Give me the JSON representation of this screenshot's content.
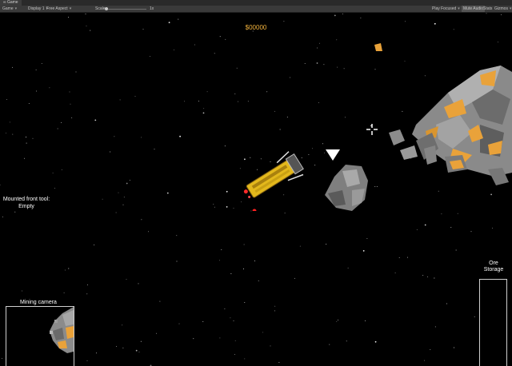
{
  "window": {
    "tab_title": "Game"
  },
  "toolbar": {
    "game_label": "Game",
    "display": "Display 1",
    "aspect": "Free Aspect",
    "scale_label": "Scale",
    "scale_value": "1x",
    "play_mode": "Play Focused",
    "mute_audio": "Mute Audio",
    "stats": "Stats",
    "gizmos": "Gizmos"
  },
  "hud": {
    "credits": "$00000",
    "mounted_tool": "Mounted front tool:\nEmpty",
    "mining_camera_label": "Mining camera",
    "ore_storage_label": "Ore\nStorage",
    "ore_storage_fill": 0
  },
  "colors": {
    "credits": "#f2b33d",
    "background": "#000000",
    "hud_text": "#ffffff",
    "ore_gold": "#e9a23a",
    "ship_yellow": "#e3b81c"
  },
  "icons": {
    "crosshair": "crosshair-icon",
    "target_marker": "target-marker-icon"
  }
}
